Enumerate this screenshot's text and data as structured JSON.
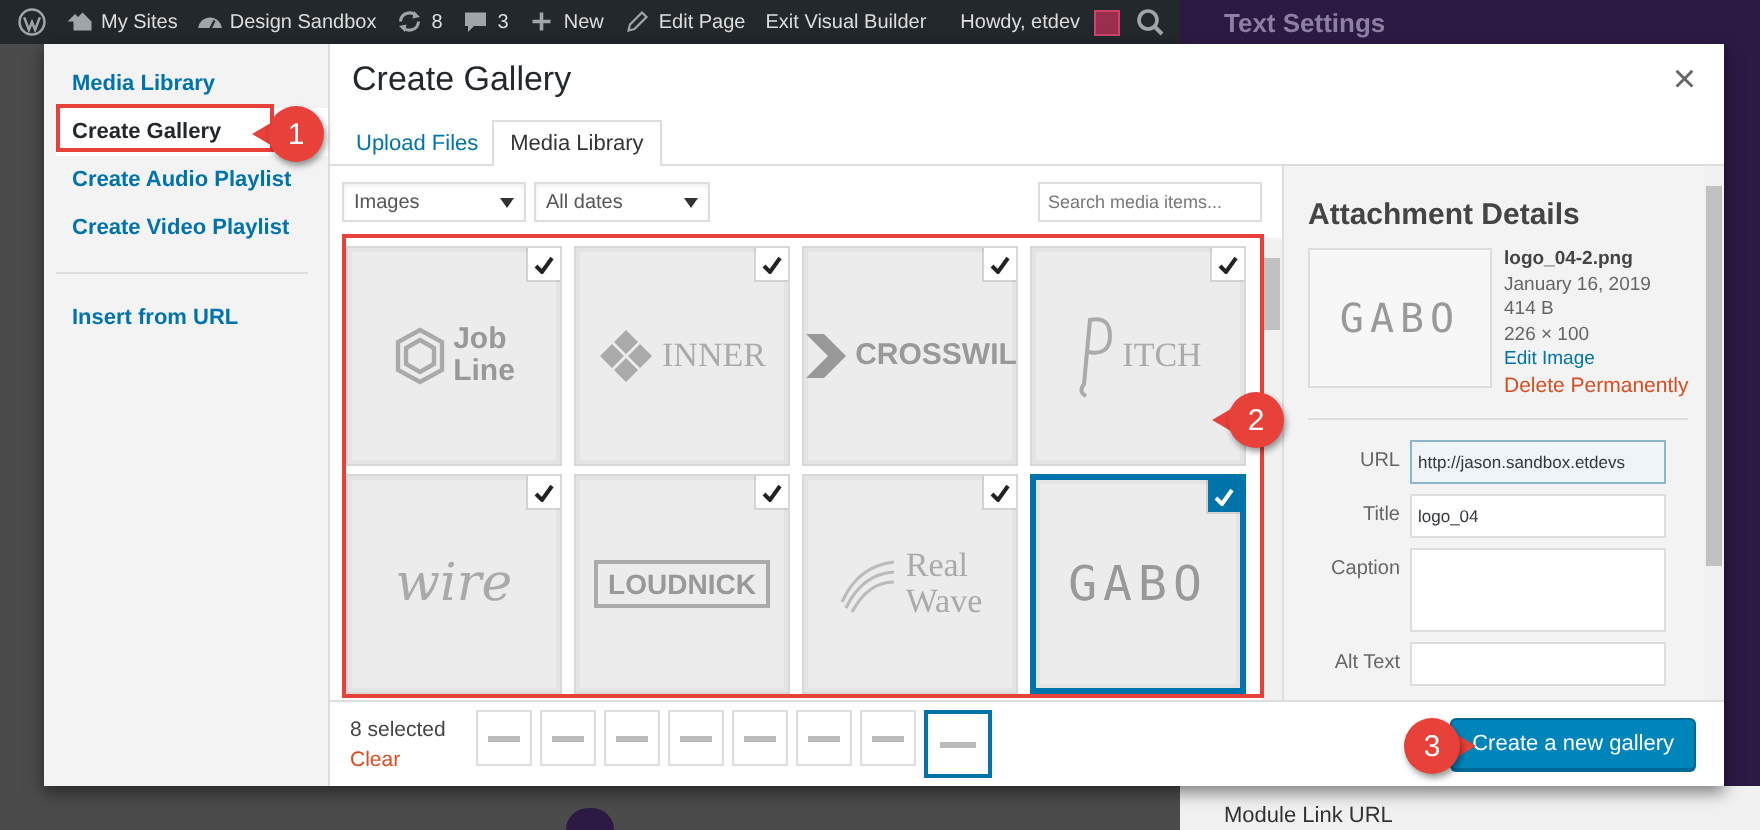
{
  "admin_bar": {
    "items": [
      {
        "kind": "wp-logo"
      },
      {
        "kind": "sites",
        "label": "My Sites"
      },
      {
        "kind": "gauge",
        "label": "Design Sandbox"
      },
      {
        "kind": "updates",
        "label": "8"
      },
      {
        "kind": "comments",
        "label": "3"
      },
      {
        "kind": "plus",
        "label": "New"
      },
      {
        "kind": "pencil",
        "label": "Edit Page"
      },
      {
        "kind": "plain",
        "label": "Exit Visual Builder"
      }
    ],
    "greeting": "Howdy, etdev"
  },
  "background": {
    "panel_title": "Text Settings",
    "field_label": "Module Link URL"
  },
  "modal": {
    "title": "Create Gallery",
    "close": "×",
    "sidebar": [
      {
        "label": "Media Library",
        "selected": false,
        "divider_above": false
      },
      {
        "label": "Create Gallery",
        "selected": true,
        "divider_above": false
      },
      {
        "label": "Create Audio Playlist",
        "selected": false,
        "divider_above": false
      },
      {
        "label": "Create Video Playlist",
        "selected": false,
        "divider_above": false
      },
      {
        "label": "Insert from URL",
        "selected": false,
        "divider_above": true
      }
    ],
    "tabs": [
      {
        "label": "Upload Files",
        "selected": false
      },
      {
        "label": "Media Library",
        "selected": true
      }
    ],
    "filters": [
      {
        "value": "Images"
      },
      {
        "value": "All dates"
      }
    ],
    "search": {
      "placeholder": "Search media items..."
    },
    "items": [
      {
        "logo": [
          "Job",
          "Line"
        ],
        "kind": "hexagon",
        "checked": true,
        "selected": false
      },
      {
        "logo": [
          "INNER"
        ],
        "kind": "diamond",
        "checked": true,
        "selected": false
      },
      {
        "logo": [
          "CROSSWIL"
        ],
        "kind": "chevron",
        "checked": true,
        "selected": false
      },
      {
        "logo": [
          "ITCH"
        ],
        "kind": "monogram",
        "checked": true,
        "selected": false
      },
      {
        "logo": [
          "wire"
        ],
        "kind": "script",
        "checked": true,
        "selected": false
      },
      {
        "logo": [
          "LOUDNICK"
        ],
        "kind": "boxed",
        "checked": true,
        "selected": false
      },
      {
        "logo": [
          "Real",
          "Wave"
        ],
        "kind": "waves",
        "checked": true,
        "selected": false
      },
      {
        "logo": [
          "GABO"
        ],
        "kind": "wide",
        "checked": true,
        "selected": true
      }
    ],
    "details": {
      "heading": "Attachment Details",
      "preview_logo": "GABO",
      "filename": "logo_04-2.png",
      "date": "January 16, 2019",
      "size": "414 B",
      "dimensions": "226 × 100",
      "edit_link": "Edit Image",
      "delete_link": "Delete Permanently",
      "fields": [
        {
          "label": "URL",
          "kind": "input",
          "value": "http://jason.sandbox.etdevs",
          "readonly": true
        },
        {
          "label": "Title",
          "kind": "input",
          "value": "logo_04",
          "readonly": false
        },
        {
          "label": "Caption",
          "kind": "textarea",
          "readonly": false
        },
        {
          "label": "Alt Text",
          "kind": "input",
          "readonly": false
        }
      ]
    },
    "footer": {
      "count": "8 selected",
      "clear": "Clear",
      "button": "Create a new gallery"
    }
  },
  "callouts": [
    {
      "number": "1",
      "kind": "sidebar"
    },
    {
      "number": "2",
      "kind": "grid"
    },
    {
      "number": "3",
      "kind": "button"
    }
  ]
}
